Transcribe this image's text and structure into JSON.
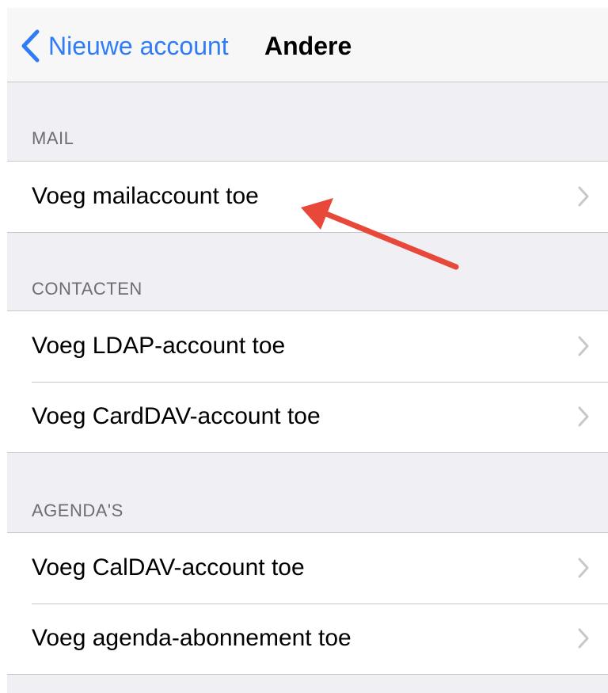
{
  "navbar": {
    "back_label": "Nieuwe account",
    "title": "Andere"
  },
  "sections": [
    {
      "header": "MAIL",
      "rows": [
        "Voeg mailaccount toe"
      ]
    },
    {
      "header": "CONTACTEN",
      "rows": [
        "Voeg LDAP-account toe",
        "Voeg CardDAV-account toe"
      ]
    },
    {
      "header": "AGENDA'S",
      "rows": [
        "Voeg CalDAV-account toe",
        "Voeg agenda-abonnement toe"
      ]
    }
  ],
  "colors": {
    "accent": "#2f7cf6",
    "background": "#efeff4",
    "annotation_arrow": "#e8483a"
  },
  "icons": {
    "back": "chevron-left-icon",
    "row": "chevron-right-icon",
    "annotation": "red-arrow-annotation"
  }
}
